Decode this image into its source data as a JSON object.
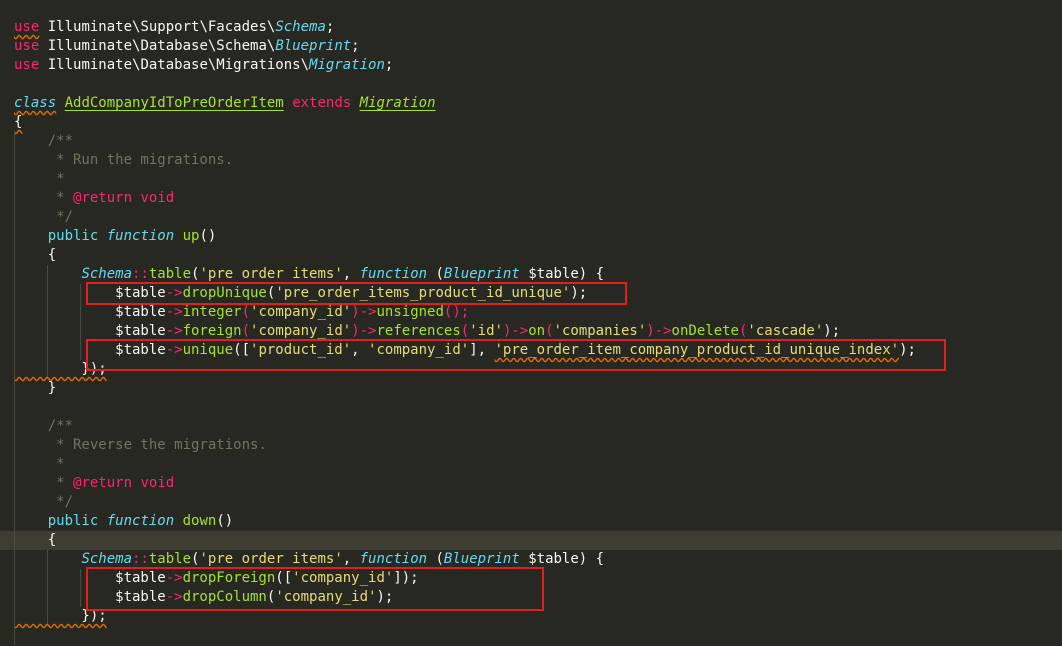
{
  "editor": {
    "colors": {
      "background": "#272822",
      "keyword": "#f92672",
      "storage": "#66d9ef",
      "function": "#a6e22e",
      "string": "#e6db74",
      "comment": "#75715e",
      "highlight_box": "#e0201e"
    },
    "lines": {
      "l1": {
        "t0": "use",
        "t1": " Illuminate\\Support\\Facades\\",
        "t2": "Schema",
        "t3": ";"
      },
      "l2": {
        "t0": "use",
        "t1": " Illuminate\\Database\\Schema\\",
        "t2": "Blueprint",
        "t3": ";"
      },
      "l3": {
        "t0": "use",
        "t1": " Illuminate\\Database\\Migrations\\",
        "t2": "Migration",
        "t3": ";"
      },
      "l5": {
        "t0": "class",
        "t1": " ",
        "t2": "AddCompanyIdToPreOrderItem",
        "t3": " ",
        "t4": "extends",
        "t5": " ",
        "t6": "Migration"
      },
      "l6": {
        "t0": "{"
      },
      "l7": {
        "t0": "    /**"
      },
      "l8": {
        "t0": "     * Run the migrations."
      },
      "l9": {
        "t0": "     *"
      },
      "l10": {
        "t0": "     * ",
        "t1": "@return",
        "t2": " void"
      },
      "l11": {
        "t0": "     */"
      },
      "l12": {
        "t0": "    ",
        "t1": "public",
        "t2": " ",
        "t3": "function",
        "t4": " ",
        "t5": "up",
        "t6": "()"
      },
      "l13": {
        "t0": "    {"
      },
      "l14": {
        "t0": "        ",
        "t1": "Schema",
        "t2": "::",
        "t3": "table",
        "t4": "(",
        "t5": "'pre order items'",
        "t6": ", ",
        "t7": "function",
        "t8": " (",
        "t9": "Blueprint",
        "t10": " $table",
        "t11": ") {"
      },
      "l15": {
        "t0": "            $table",
        "t1": "->",
        "t2": "dropUnique",
        "t3": "(",
        "t4": "'pre_order_items_product_id_unique'",
        "t5": ");"
      },
      "l16": {
        "t0": "            $table",
        "t1": "->",
        "t2": "integer",
        "t3": "(",
        "t4": "'company_id'",
        "t5": ")",
        "t6": "->",
        "t7": "unsigned",
        "t8": "();"
      },
      "l17": {
        "t0": "            $table",
        "t1": "->",
        "t2": "foreign",
        "t3": "(",
        "t4": "'company_id'",
        "t5": ")",
        "t6": "->",
        "t7": "references",
        "t8": "(",
        "t9": "'id'",
        "t10": ")",
        "t11": "->",
        "t12": "on",
        "t13": "(",
        "t14": "'companies'",
        "t15": ")",
        "t16": "->",
        "t17": "onDelete",
        "t18": "(",
        "t19": "'cascade'",
        "t20": ");"
      },
      "l18": {
        "t0": "            $table",
        "t1": "->",
        "t2": "unique",
        "t3": "([",
        "t4": "'product_id'",
        "t5": ", ",
        "t6": "'company_id'",
        "t7": "], ",
        "t8": "'pre_order_item_company_product_id_unique_index'",
        "t9": ");"
      },
      "l19": {
        "t0": "        });"
      },
      "l20": {
        "t0": "    }"
      },
      "l22": {
        "t0": "    /**"
      },
      "l23": {
        "t0": "     * Reverse the migrations."
      },
      "l24": {
        "t0": "     *"
      },
      "l25": {
        "t0": "     * ",
        "t1": "@return",
        "t2": " void"
      },
      "l26": {
        "t0": "     */"
      },
      "l27": {
        "t0": "    ",
        "t1": "public",
        "t2": " ",
        "t3": "function",
        "t4": " ",
        "t5": "down",
        "t6": "()"
      },
      "l28": {
        "t0": "    {"
      },
      "l29": {
        "t0": "        ",
        "t1": "Schema",
        "t2": "::",
        "t3": "table",
        "t4": "(",
        "t5": "'pre order items'",
        "t6": ", ",
        "t7": "function",
        "t8": " (",
        "t9": "Blueprint",
        "t10": " $table",
        "t11": ") {"
      },
      "l30": {
        "t0": "            $table",
        "t1": "->",
        "t2": "dropForeign",
        "t3": "([",
        "t4": "'company_id'",
        "t5": "]);"
      },
      "l31": {
        "t0": "            $table",
        "t1": "->",
        "t2": "dropColumn",
        "t3": "(",
        "t4": "'company_id'",
        "t5": ");"
      },
      "l32": {
        "t0": "        });"
      }
    }
  }
}
